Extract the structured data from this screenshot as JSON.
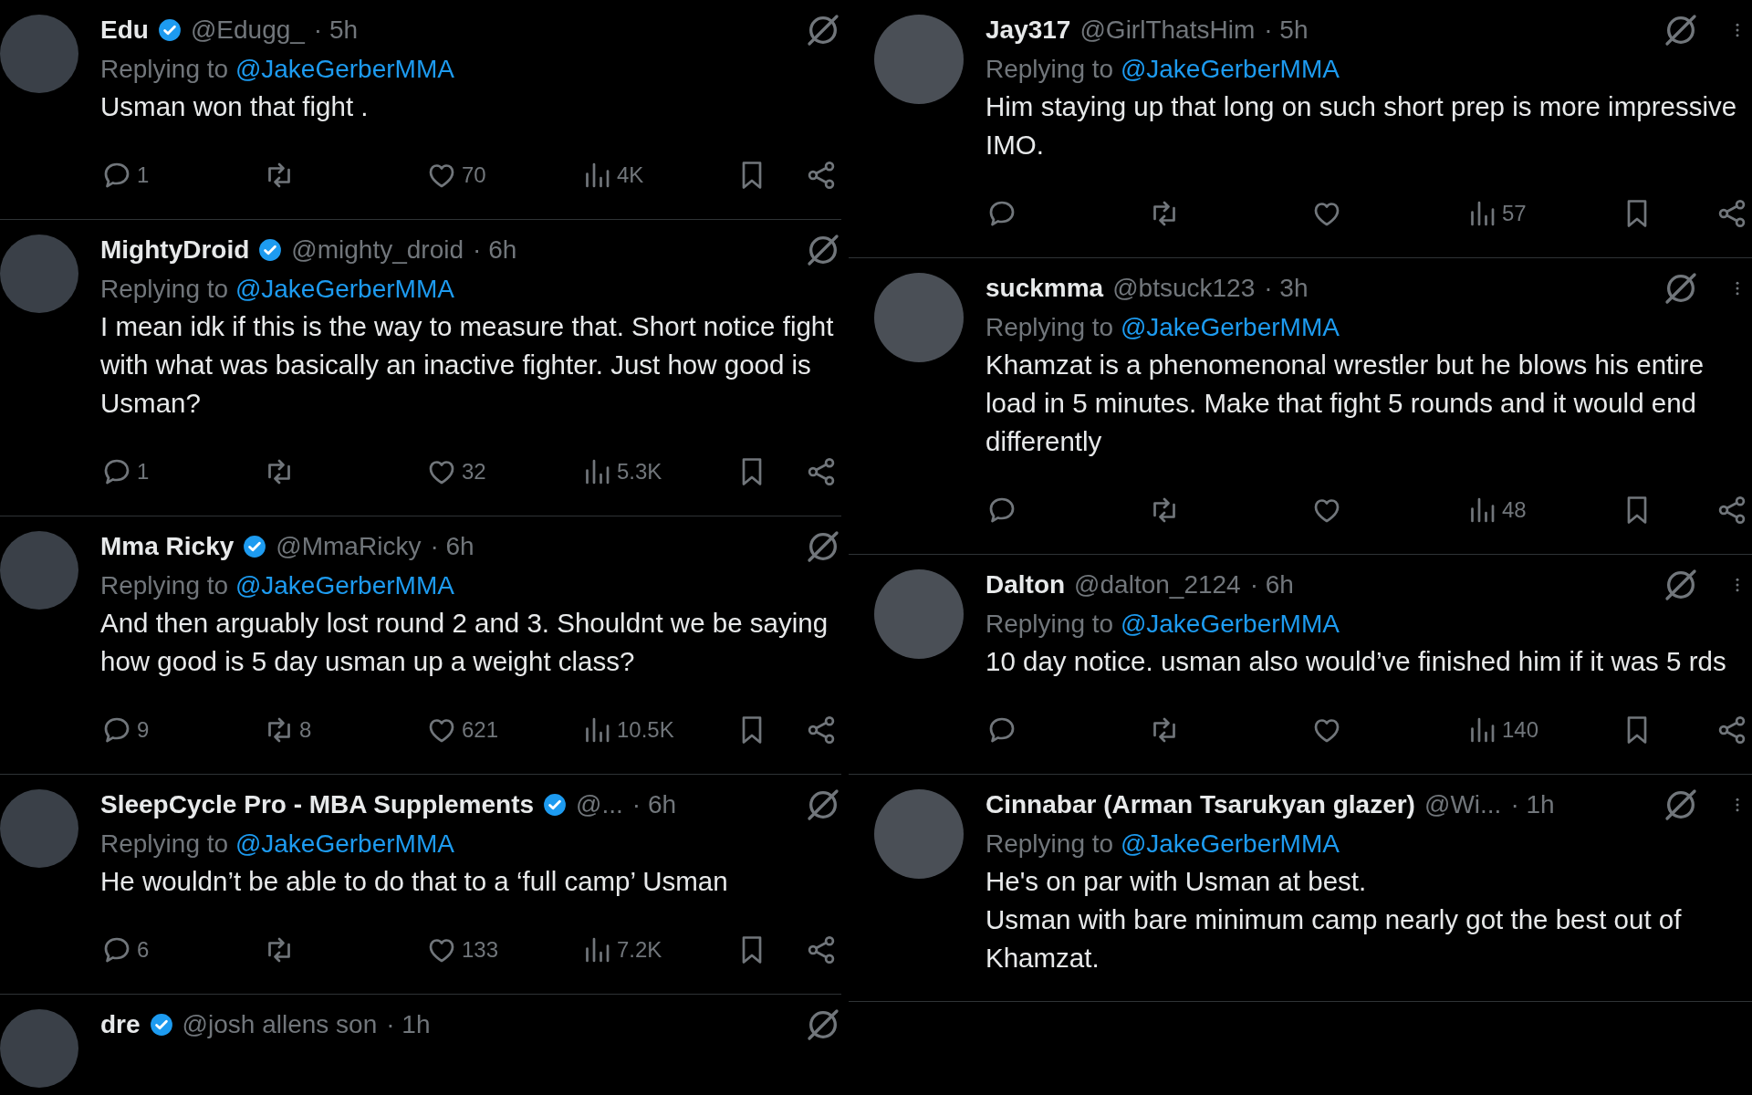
{
  "left_column": {
    "tweets": [
      {
        "display_name": "Edu",
        "verified": true,
        "handle": "@Edugg_",
        "time": "· 5h",
        "replying_label": "Replying to",
        "replying_to": "@JakeGerberMMA",
        "text": "Usman won that fight .",
        "stats": {
          "replies": "1",
          "likes": "70",
          "views": "4K"
        }
      },
      {
        "display_name": "MightyDroid",
        "verified": true,
        "handle": "@mighty_droid",
        "time": "· 6h",
        "replying_label": "Replying to",
        "replying_to": "@JakeGerberMMA",
        "text": "I mean idk if this is the way to measure that. Short notice fight with what was basically an inactive fighter. Just how good is Usman?",
        "stats": {
          "replies": "1",
          "likes": "32",
          "views": "5.3K"
        }
      },
      {
        "display_name": "Mma Ricky",
        "verified": true,
        "handle": "@MmaRicky",
        "time": "· 6h",
        "replying_label": "Replying to",
        "replying_to": "@JakeGerberMMA",
        "text": "And then arguably lost round 2 and 3. Shouldnt we be saying how good is 5 day usman up a weight class?",
        "stats": {
          "replies": "9",
          "reposts": "8",
          "likes": "621",
          "views": "10.5K"
        }
      },
      {
        "display_name": "SleepCycle Pro - MBA Supplements",
        "verified": true,
        "handle": "@...",
        "time": "· 6h",
        "replying_label": "Replying to",
        "replying_to": "@JakeGerberMMA",
        "text": "He wouldn’t be able to do that to a ‘full camp’ Usman",
        "stats": {
          "replies": "6",
          "likes": "133",
          "views": "7.2K"
        }
      },
      {
        "display_name": "dre",
        "verified": true,
        "handle": "@josh allens son",
        "time": "· 1h"
      }
    ]
  },
  "right_column": {
    "tweets": [
      {
        "display_name": "Jay317",
        "handle": "@GirlThatsHim",
        "time": "· 5h",
        "replying_label": "Replying to",
        "replying_to": "@JakeGerberMMA",
        "text": "Him staying up that long on such short prep is more impressive IMO.",
        "more_menu": true,
        "stats": {
          "views": "57"
        }
      },
      {
        "display_name": "suckmma",
        "handle": "@btsuck123",
        "time": "· 3h",
        "replying_label": "Replying to",
        "replying_to": "@JakeGerberMMA",
        "text": "Khamzat is a phenomenonal wrestler but he blows his entire load in 5 minutes. Make that fight 5 rounds and it would end differently",
        "more_menu": true,
        "stats": {
          "views": "48"
        }
      },
      {
        "display_name": "Dalton",
        "handle": "@dalton_2124",
        "time": "· 6h",
        "replying_label": "Replying to",
        "replying_to": "@JakeGerberMMA",
        "text": "10 day notice. usman also would’ve finished him if it was 5 rds",
        "more_menu": true,
        "stats": {
          "views": "140"
        }
      },
      {
        "display_name": "Cinnabar (Arman Tsarukyan glazer)",
        "handle": "@Wi...",
        "time": "· 1h",
        "replying_label": "Replying to",
        "replying_to": "@JakeGerberMMA",
        "text": "He's on par with Usman at best.\nUsman with bare minimum camp nearly got the best out of Khamzat.",
        "more_menu": true
      }
    ]
  }
}
